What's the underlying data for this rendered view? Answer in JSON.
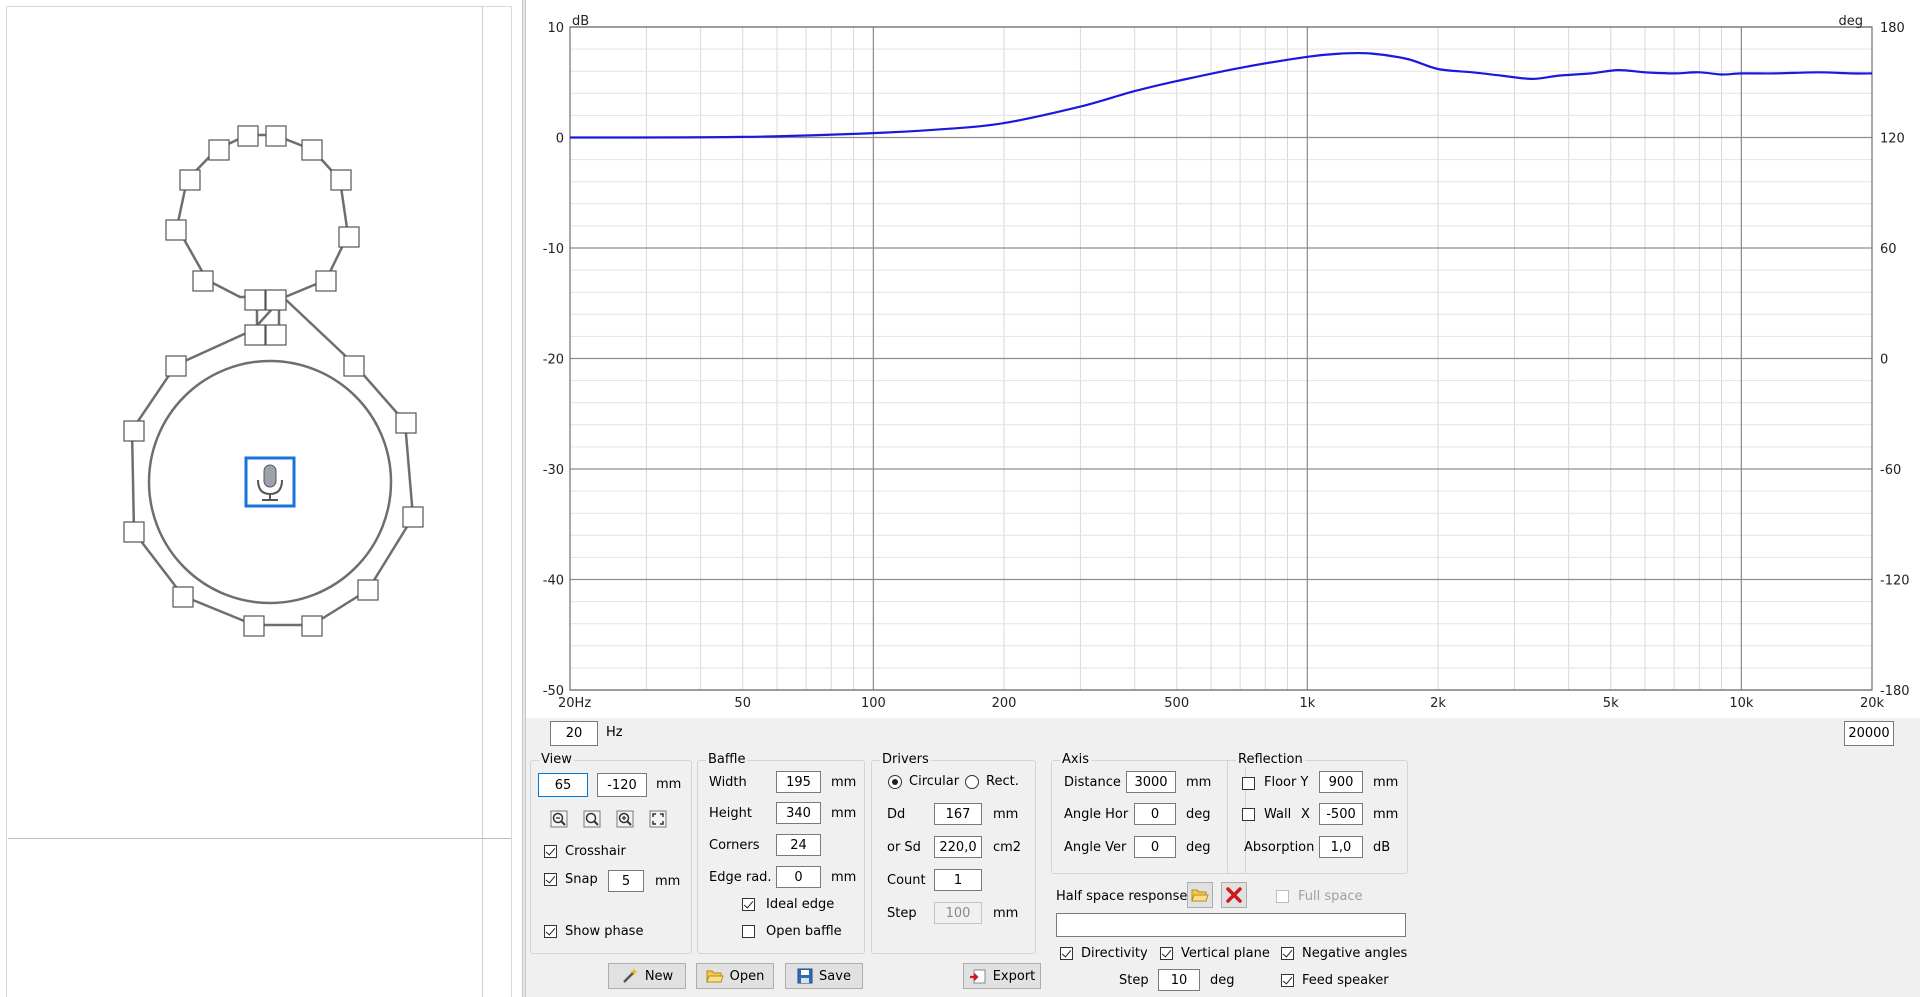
{
  "chart_data": {
    "type": "line",
    "ylabel_left": "dB",
    "ylabel_right": "deg",
    "x_scale": "log",
    "xlim": [
      20,
      20000
    ],
    "ylim_left": [
      -50,
      10
    ],
    "ylim_right": [
      -180,
      180
    ],
    "x_tick_labels": [
      "20Hz",
      "50",
      "100",
      "200",
      "500",
      "1k",
      "2k",
      "5k",
      "10k",
      "20k"
    ],
    "x_tick_values": [
      20,
      50,
      100,
      200,
      500,
      1000,
      2000,
      5000,
      10000,
      20000
    ],
    "y_left_tick_labels": [
      "10",
      "0",
      "-10",
      "-20",
      "-30",
      "-40",
      "-50"
    ],
    "y_right_tick_labels": [
      "180",
      "120",
      "60",
      "0",
      "-60",
      "-120",
      "-180"
    ],
    "grid": true,
    "series": [
      {
        "color": "#1a1adf",
        "x": [
          20,
          50,
          100,
          150,
          200,
          300,
          400,
          500,
          700,
          1000,
          1200,
          1400,
          1700,
          2000,
          2400,
          2800,
          3300,
          3800,
          4500,
          5200,
          6000,
          7000,
          8000,
          9000,
          10000,
          12000,
          15000,
          18000,
          20000
        ],
        "y": [
          0.0,
          0.05,
          0.4,
          0.8,
          1.3,
          2.8,
          4.2,
          5.1,
          6.3,
          7.3,
          7.6,
          7.6,
          7.1,
          6.2,
          5.9,
          5.6,
          5.3,
          5.6,
          5.8,
          6.1,
          5.9,
          5.8,
          5.9,
          5.7,
          5.8,
          5.8,
          5.9,
          5.8,
          5.8
        ]
      }
    ]
  },
  "freq_min": "20",
  "freq_unit": "Hz",
  "freq_max": "20000",
  "view": {
    "title": "View",
    "x": "65",
    "y": "-120",
    "unit": "mm",
    "crosshair_label": "Crosshair",
    "crosshair": true,
    "snap_label": "Snap",
    "snap": true,
    "snap_value": "5",
    "snap_unit": "mm",
    "show_phase_label": "Show phase",
    "show_phase": true
  },
  "baffle": {
    "title": "Baffle",
    "width_label": "Width",
    "width": "195",
    "width_unit": "mm",
    "height_label": "Height",
    "height": "340",
    "height_unit": "mm",
    "corners_label": "Corners",
    "corners": "24",
    "edge_label": "Edge rad.",
    "edge": "0",
    "edge_unit": "mm",
    "ideal_edge_label": "Ideal edge",
    "ideal_edge": true,
    "open_baffle_label": "Open baffle",
    "open_baffle": false
  },
  "drivers": {
    "title": "Drivers",
    "circular_label": "Circular",
    "rect_label": "Rect.",
    "dd_label": "Dd",
    "dd": "167",
    "dd_unit": "mm",
    "sd_label": "or Sd",
    "sd": "220,0",
    "sd_unit": "cm2",
    "count_label": "Count",
    "count": "1",
    "step_label": "Step",
    "step": "100",
    "step_unit": "mm"
  },
  "axis": {
    "title": "Axis",
    "distance_label": "Distance",
    "distance": "3000",
    "distance_unit": "mm",
    "angle_hor_label": "Angle Hor",
    "angle_hor": "0",
    "angle_hor_unit": "deg",
    "angle_ver_label": "Angle Ver",
    "angle_ver": "0",
    "angle_ver_unit": "deg"
  },
  "reflection": {
    "title": "Reflection",
    "floor_label": "Floor Y",
    "floor": "900",
    "floor_unit": "mm",
    "wall_label": "Wall",
    "wall_axis": "X",
    "wall": "-500",
    "wall_unit": "mm",
    "absorption_label": "Absorption",
    "absorption": "1,0",
    "absorption_unit": "dB"
  },
  "half_space": {
    "label": "Half space response",
    "full_space_label": "Full space",
    "path": ""
  },
  "options": {
    "directivity_label": "Directivity",
    "vertical_plane_label": "Vertical plane",
    "negative_angles_label": "Negative angles",
    "step_label": "Step",
    "step": "10",
    "step_unit": "deg",
    "feed_speaker_label": "Feed speaker"
  },
  "buttons": {
    "new": "New",
    "open": "Open",
    "save": "Save",
    "export": "Export"
  }
}
